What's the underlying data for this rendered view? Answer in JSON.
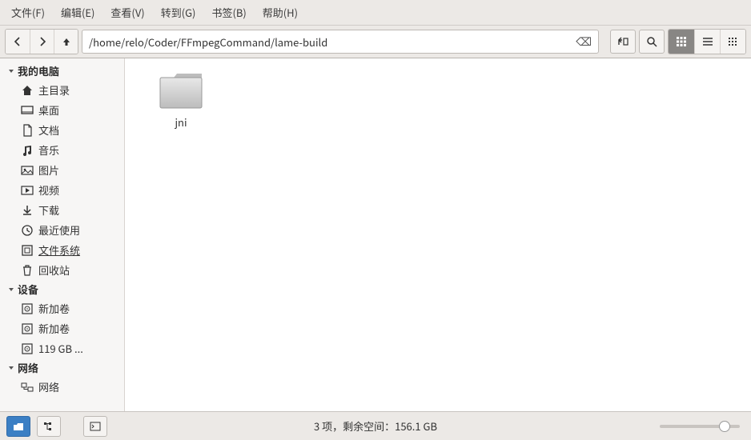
{
  "menu": [
    "文件(F)",
    "编辑(E)",
    "查看(V)",
    "转到(G)",
    "书签(B)",
    "帮助(H)"
  ],
  "path": "/home/relo/Coder/FFmpegCommand/lame-build",
  "sidebar": {
    "sections": [
      {
        "title": "我的电脑",
        "items": [
          {
            "icon": "home",
            "label": "主目录",
            "sel": false
          },
          {
            "icon": "desktop",
            "label": "桌面",
            "sel": false
          },
          {
            "icon": "doc",
            "label": "文档",
            "sel": false
          },
          {
            "icon": "music",
            "label": "音乐",
            "sel": false
          },
          {
            "icon": "pic",
            "label": "图片",
            "sel": false
          },
          {
            "icon": "video",
            "label": "视频",
            "sel": false
          },
          {
            "icon": "download",
            "label": "下载",
            "sel": false
          },
          {
            "icon": "recent",
            "label": "最近使用",
            "sel": false
          },
          {
            "icon": "fs",
            "label": "文件系统",
            "sel": true
          },
          {
            "icon": "trash",
            "label": "回收站",
            "sel": false
          }
        ]
      },
      {
        "title": "设备",
        "items": [
          {
            "icon": "disk",
            "label": "新加卷",
            "sel": false
          },
          {
            "icon": "disk",
            "label": "新加卷",
            "sel": false
          },
          {
            "icon": "disk",
            "label": "119 GB ...",
            "sel": false
          }
        ]
      },
      {
        "title": "网络",
        "items": [
          {
            "icon": "net",
            "label": "网络",
            "sel": false
          }
        ]
      }
    ]
  },
  "files": [
    {
      "name": "jni",
      "type": "folder"
    }
  ],
  "status": "3 项，剩余空间：156.1 GB"
}
